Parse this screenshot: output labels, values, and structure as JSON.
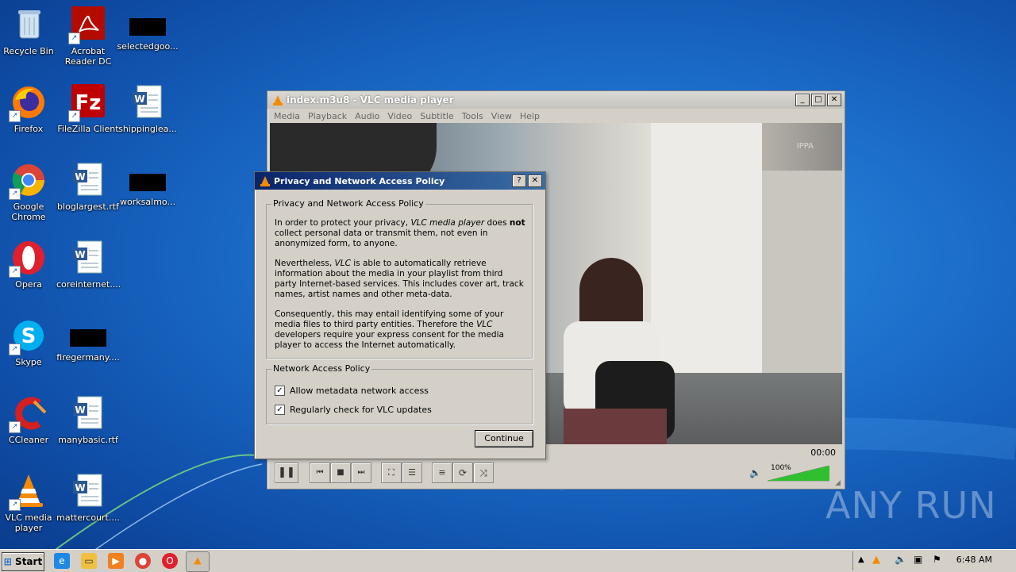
{
  "desktop_icons": [
    {
      "label": "Recycle Bin",
      "icon": "recycle-bin-icon"
    },
    {
      "label": "Acrobat Reader DC",
      "icon": "acrobat-icon"
    },
    {
      "label": "selectedgoo...",
      "icon": "black-thumbnail-icon"
    },
    {
      "label": "Firefox",
      "icon": "firefox-icon"
    },
    {
      "label": "FileZilla Client",
      "icon": "filezilla-icon"
    },
    {
      "label": "shippinglea...",
      "icon": "word-doc-icon"
    },
    {
      "label": "Google Chrome",
      "icon": "chrome-icon"
    },
    {
      "label": "bloglargest.rtf",
      "icon": "word-doc-icon"
    },
    {
      "label": "worksalmo...",
      "icon": "black-thumbnail-icon"
    },
    {
      "label": "Opera",
      "icon": "opera-icon"
    },
    {
      "label": "coreinternet....",
      "icon": "word-doc-icon"
    },
    {
      "label": "Skype",
      "icon": "skype-icon"
    },
    {
      "label": "firegermany....",
      "icon": "black-thumbnail-icon"
    },
    {
      "label": "CCleaner",
      "icon": "ccleaner-icon"
    },
    {
      "label": "manybasic.rtf",
      "icon": "word-doc-icon"
    },
    {
      "label": "VLC media player",
      "icon": "vlc-icon"
    },
    {
      "label": "mattercourt....",
      "icon": "word-doc-icon"
    }
  ],
  "vlc": {
    "title": "index.m3u8 - VLC media player",
    "menu": [
      "Media",
      "Playback",
      "Audio",
      "Video",
      "Subtitle",
      "Tools",
      "View",
      "Help"
    ],
    "time": "00:00",
    "volume": "100%",
    "volume_level": 1.0,
    "watermark_brand": "IPPA"
  },
  "dialog": {
    "title": "Privacy and Network Access Policy",
    "help_btn": "?",
    "close_btn": "✕",
    "group1_title": "Privacy and Network Access Policy",
    "p1_a": "In order to protect your privacy, ",
    "p1_em": "VLC media player",
    "p1_b": " does ",
    "p1_strong": "not",
    "p1_c": " collect personal data or transmit them, not even in anonymized form, to anyone.",
    "p2_a": "Nevertheless, ",
    "p2_em": "VLC",
    "p2_b": " is able to automatically retrieve information about the media in your playlist from third party Internet-based services. This includes cover art, track names, artist names and other meta-data.",
    "p3_a": "Consequently, this may entail identifying some of your media files to third party entities. Therefore the ",
    "p3_em": "VLC",
    "p3_b": " developers require your express consent for the media player to access the Internet automatically.",
    "group2_title": "Network Access Policy",
    "check1": "Allow metadata network access",
    "check2": "Regularly check for VLC updates",
    "check1_checked": true,
    "check2_checked": true,
    "continue": "Continue"
  },
  "taskbar": {
    "start": "Start",
    "clock": "6:48 AM"
  },
  "watermark": "ANY RUN"
}
